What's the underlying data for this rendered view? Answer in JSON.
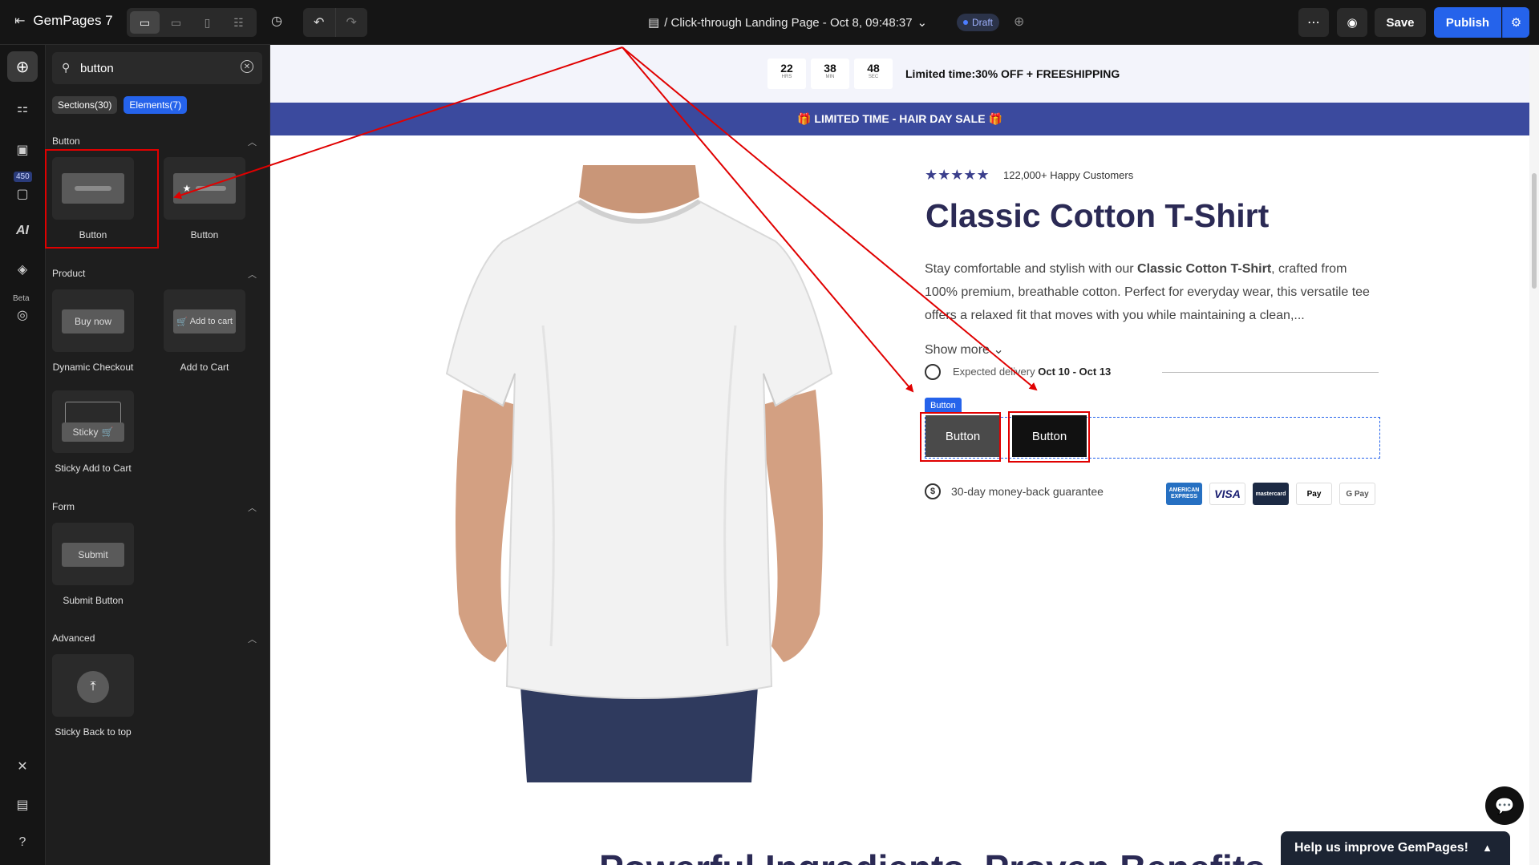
{
  "topbar": {
    "brand": "GemPages 7",
    "page_title": "/ Click-through Landing Page - Oct 8, 09:48:37",
    "status": "Draft",
    "save_label": "Save",
    "publish_label": "Publish"
  },
  "rail": {
    "badge": "450",
    "ai_label": "AI",
    "beta_label": "Beta"
  },
  "panel": {
    "search_value": "button",
    "tabs": [
      {
        "label": "Sections(30)"
      },
      {
        "label": "Elements(7)"
      }
    ],
    "categories": {
      "button": "Button",
      "product": "Product",
      "form": "Form",
      "advanced": "Advanced"
    },
    "tiles": {
      "button1": "Button",
      "button2": "Button",
      "dynamic_checkout": "Dynamic Checkout",
      "dynamic_checkout_preview": "Buy now",
      "add_to_cart": "Add to Cart",
      "add_to_cart_preview": "Add to cart",
      "sticky_add_to_cart": "Sticky Add to Cart",
      "sticky_preview": "Sticky",
      "submit_button": "Submit Button",
      "submit_preview": "Submit",
      "sticky_back_to_top": "Sticky Back to top"
    }
  },
  "canvas": {
    "timer": [
      {
        "value": "22",
        "unit": "HRS"
      },
      {
        "value": "38",
        "unit": "MIN"
      },
      {
        "value": "48",
        "unit": "SEC"
      }
    ],
    "limited_text": "Limited time:30% OFF + FREESHIPPING",
    "sale_banner": "🎁 LIMITED TIME - HAIR DAY SALE 🎁",
    "stars": "★★★★★",
    "reviews": "122,000+ Happy Customers",
    "product_title": "Classic Cotton T-Shirt",
    "desc_prefix": "Stay comfortable and stylish with our ",
    "desc_bold": "Classic Cotton T-Shirt",
    "desc_suffix": ", crafted from 100% premium, breathable cotton. Perfect for everyday wear, this versatile tee offers a relaxed fit that moves with you while maintaining a clean,...",
    "show_more": "Show more",
    "delivery_label": "Expected delivery",
    "delivery_dates": "Oct 10 - Oct 13",
    "button_badge": "Button",
    "button1": "Button",
    "button2": "Button",
    "guarantee": "30-day money-back guarantee",
    "payments": [
      "AMERICAN EXPRESS",
      "VISA",
      "mastercard",
      "Pay",
      "G Pay"
    ],
    "bottom_heading": "Powerful Ingredients, Proven Benefits"
  },
  "help": {
    "label": "Help us improve GemPages!"
  },
  "colors": {
    "accent": "#2563eb",
    "sale_banner": "#3b4a9e",
    "title": "#2b2a55",
    "annotation": "#e00000"
  }
}
